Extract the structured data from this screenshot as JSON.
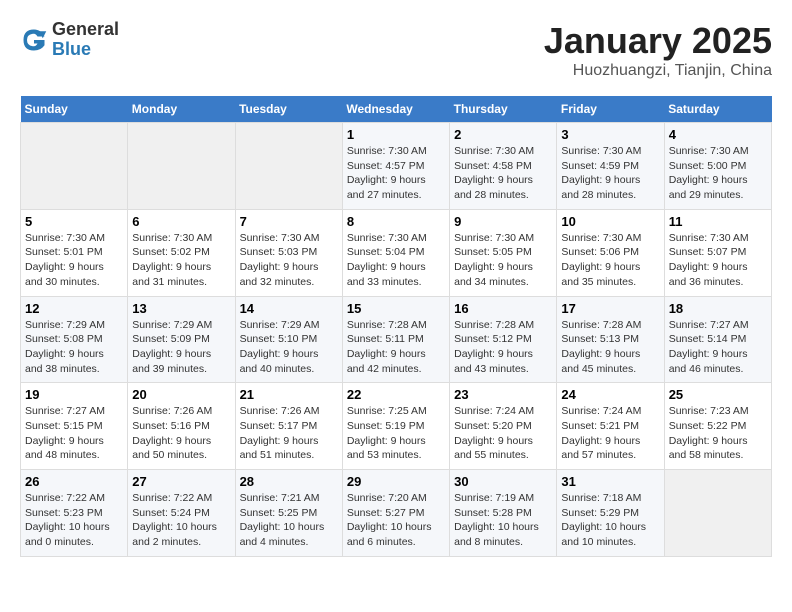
{
  "header": {
    "logo": {
      "general": "General",
      "blue": "Blue"
    },
    "title": "January 2025",
    "subtitle": "Huozhuangzi, Tianjin, China"
  },
  "weekdays": [
    "Sunday",
    "Monday",
    "Tuesday",
    "Wednesday",
    "Thursday",
    "Friday",
    "Saturday"
  ],
  "weeks": [
    [
      {
        "day": "",
        "info": ""
      },
      {
        "day": "",
        "info": ""
      },
      {
        "day": "",
        "info": ""
      },
      {
        "day": "1",
        "info": "Sunrise: 7:30 AM\nSunset: 4:57 PM\nDaylight: 9 hours and 27 minutes."
      },
      {
        "day": "2",
        "info": "Sunrise: 7:30 AM\nSunset: 4:58 PM\nDaylight: 9 hours and 28 minutes."
      },
      {
        "day": "3",
        "info": "Sunrise: 7:30 AM\nSunset: 4:59 PM\nDaylight: 9 hours and 28 minutes."
      },
      {
        "day": "4",
        "info": "Sunrise: 7:30 AM\nSunset: 5:00 PM\nDaylight: 9 hours and 29 minutes."
      }
    ],
    [
      {
        "day": "5",
        "info": "Sunrise: 7:30 AM\nSunset: 5:01 PM\nDaylight: 9 hours and 30 minutes."
      },
      {
        "day": "6",
        "info": "Sunrise: 7:30 AM\nSunset: 5:02 PM\nDaylight: 9 hours and 31 minutes."
      },
      {
        "day": "7",
        "info": "Sunrise: 7:30 AM\nSunset: 5:03 PM\nDaylight: 9 hours and 32 minutes."
      },
      {
        "day": "8",
        "info": "Sunrise: 7:30 AM\nSunset: 5:04 PM\nDaylight: 9 hours and 33 minutes."
      },
      {
        "day": "9",
        "info": "Sunrise: 7:30 AM\nSunset: 5:05 PM\nDaylight: 9 hours and 34 minutes."
      },
      {
        "day": "10",
        "info": "Sunrise: 7:30 AM\nSunset: 5:06 PM\nDaylight: 9 hours and 35 minutes."
      },
      {
        "day": "11",
        "info": "Sunrise: 7:30 AM\nSunset: 5:07 PM\nDaylight: 9 hours and 36 minutes."
      }
    ],
    [
      {
        "day": "12",
        "info": "Sunrise: 7:29 AM\nSunset: 5:08 PM\nDaylight: 9 hours and 38 minutes."
      },
      {
        "day": "13",
        "info": "Sunrise: 7:29 AM\nSunset: 5:09 PM\nDaylight: 9 hours and 39 minutes."
      },
      {
        "day": "14",
        "info": "Sunrise: 7:29 AM\nSunset: 5:10 PM\nDaylight: 9 hours and 40 minutes."
      },
      {
        "day": "15",
        "info": "Sunrise: 7:28 AM\nSunset: 5:11 PM\nDaylight: 9 hours and 42 minutes."
      },
      {
        "day": "16",
        "info": "Sunrise: 7:28 AM\nSunset: 5:12 PM\nDaylight: 9 hours and 43 minutes."
      },
      {
        "day": "17",
        "info": "Sunrise: 7:28 AM\nSunset: 5:13 PM\nDaylight: 9 hours and 45 minutes."
      },
      {
        "day": "18",
        "info": "Sunrise: 7:27 AM\nSunset: 5:14 PM\nDaylight: 9 hours and 46 minutes."
      }
    ],
    [
      {
        "day": "19",
        "info": "Sunrise: 7:27 AM\nSunset: 5:15 PM\nDaylight: 9 hours and 48 minutes."
      },
      {
        "day": "20",
        "info": "Sunrise: 7:26 AM\nSunset: 5:16 PM\nDaylight: 9 hours and 50 minutes."
      },
      {
        "day": "21",
        "info": "Sunrise: 7:26 AM\nSunset: 5:17 PM\nDaylight: 9 hours and 51 minutes."
      },
      {
        "day": "22",
        "info": "Sunrise: 7:25 AM\nSunset: 5:19 PM\nDaylight: 9 hours and 53 minutes."
      },
      {
        "day": "23",
        "info": "Sunrise: 7:24 AM\nSunset: 5:20 PM\nDaylight: 9 hours and 55 minutes."
      },
      {
        "day": "24",
        "info": "Sunrise: 7:24 AM\nSunset: 5:21 PM\nDaylight: 9 hours and 57 minutes."
      },
      {
        "day": "25",
        "info": "Sunrise: 7:23 AM\nSunset: 5:22 PM\nDaylight: 9 hours and 58 minutes."
      }
    ],
    [
      {
        "day": "26",
        "info": "Sunrise: 7:22 AM\nSunset: 5:23 PM\nDaylight: 10 hours and 0 minutes."
      },
      {
        "day": "27",
        "info": "Sunrise: 7:22 AM\nSunset: 5:24 PM\nDaylight: 10 hours and 2 minutes."
      },
      {
        "day": "28",
        "info": "Sunrise: 7:21 AM\nSunset: 5:25 PM\nDaylight: 10 hours and 4 minutes."
      },
      {
        "day": "29",
        "info": "Sunrise: 7:20 AM\nSunset: 5:27 PM\nDaylight: 10 hours and 6 minutes."
      },
      {
        "day": "30",
        "info": "Sunrise: 7:19 AM\nSunset: 5:28 PM\nDaylight: 10 hours and 8 minutes."
      },
      {
        "day": "31",
        "info": "Sunrise: 7:18 AM\nSunset: 5:29 PM\nDaylight: 10 hours and 10 minutes."
      },
      {
        "day": "",
        "info": ""
      }
    ]
  ]
}
